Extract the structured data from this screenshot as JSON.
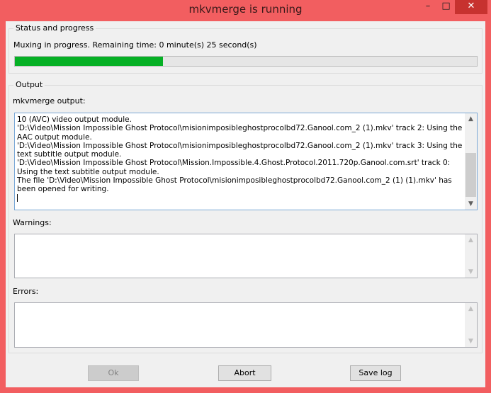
{
  "window": {
    "title": "mkvmerge is running",
    "min_glyph": "–",
    "max_glyph": "□",
    "close_glyph": "✕"
  },
  "status": {
    "group_title": "Status and progress",
    "message": "Muxing in progress.  Remaining time:  0 minute(s) 25 second(s)",
    "progress_fraction": 0.32
  },
  "output": {
    "group_title": "Output",
    "mkvmerge_label": "mkvmerge output:",
    "mkvmerge_text": "10 (AVC) video output module.\n'D:\\Video\\Mission Impossible Ghost Protocol\\misionimposibleghostprocolbd72.Ganool.com_2 (1).mkv' track 2: Using the AAC output module.\n'D:\\Video\\Mission Impossible Ghost Protocol\\misionimposibleghostprocolbd72.Ganool.com_2 (1).mkv' track 3: Using the text subtitle output module.\n'D:\\Video\\Mission Impossible Ghost Protocol\\Mission.Impossible.4.Ghost.Protocol.2011.720p.Ganool.com.srt' track 0: Using the text subtitle output module.\nThe file 'D:\\Video\\Mission Impossible Ghost Protocol\\misionimposibleghostprocolbd72.Ganool.com_2 (1) (1).mkv' has been opened for writing.\n",
    "warnings_label": "Warnings:",
    "warnings_text": "",
    "errors_label": "Errors:",
    "errors_text": ""
  },
  "buttons": {
    "ok": "Ok",
    "abort": "Abort",
    "save_log": "Save log"
  },
  "colors": {
    "titlebar": "#f25e60",
    "progress": "#06b025",
    "close_button": "#c7322f"
  }
}
